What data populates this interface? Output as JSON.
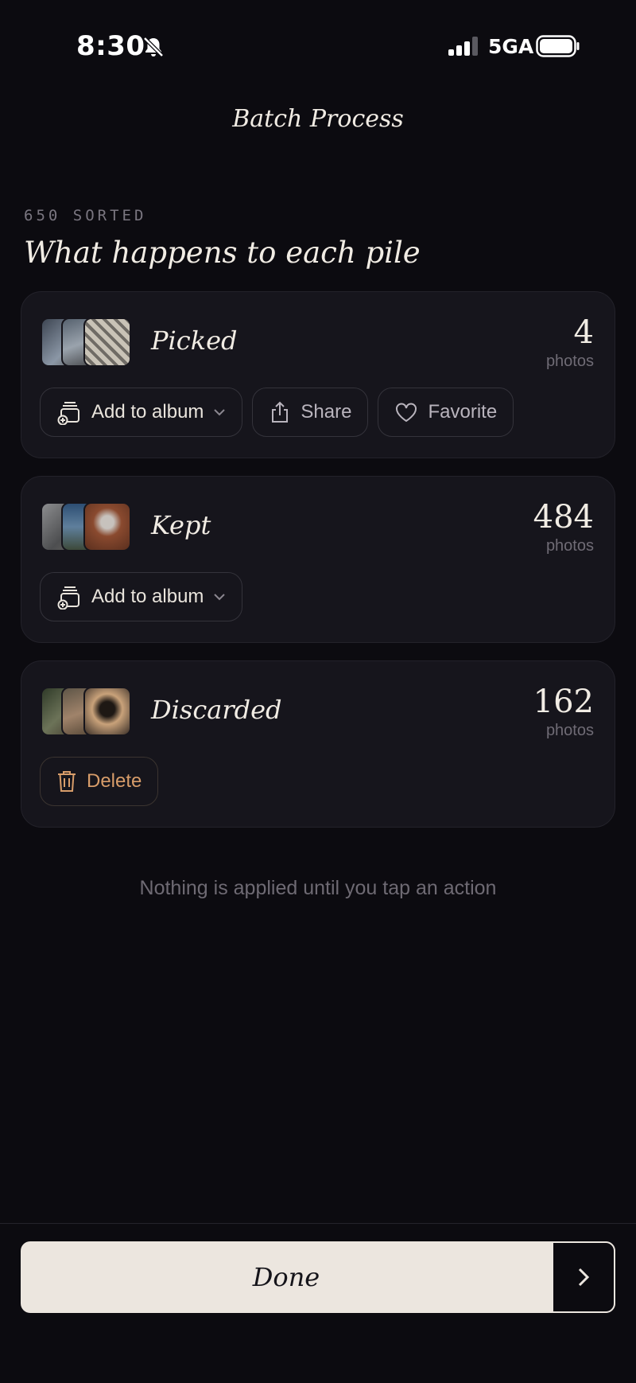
{
  "status_bar": {
    "time": "8:30",
    "network": "5GA"
  },
  "header": {
    "title": "Batch Process"
  },
  "summary": {
    "sorted_label": "650 SORTED",
    "heading": "What happens to each pile"
  },
  "piles": [
    {
      "name": "Picked",
      "count": "4",
      "unit": "photos",
      "thumb_colors": [
        "#5f6a78",
        "#77818d",
        "#a9a49a"
      ],
      "actions": [
        "Add to album",
        "Share",
        "Favorite"
      ]
    },
    {
      "name": "Kept",
      "count": "484",
      "unit": "photos",
      "thumb_colors": [
        "#6d6e70",
        "#3e5b7a",
        "#8a4a2f"
      ],
      "actions": [
        "Add to album"
      ]
    },
    {
      "name": "Discarded",
      "count": "162",
      "unit": "photos",
      "thumb_colors": [
        "#4c5340",
        "#a0836a",
        "#3a2f28"
      ],
      "actions": [
        "Delete"
      ]
    }
  ],
  "footnote": "Nothing is applied until you tap an action",
  "done_button": {
    "label": "Done"
  },
  "colors": {
    "background": "#0c0b10",
    "card": "#16151c",
    "text": "#f1ece4",
    "muted": "#6f6b75",
    "danger": "#d89d6a",
    "done_bg": "#ece6df"
  },
  "icons": [
    "bell-slash-icon",
    "signal-icon",
    "battery-icon",
    "album-add-icon",
    "chevron-down-icon",
    "share-icon",
    "heart-icon",
    "trash-icon",
    "chevron-right-icon"
  ]
}
